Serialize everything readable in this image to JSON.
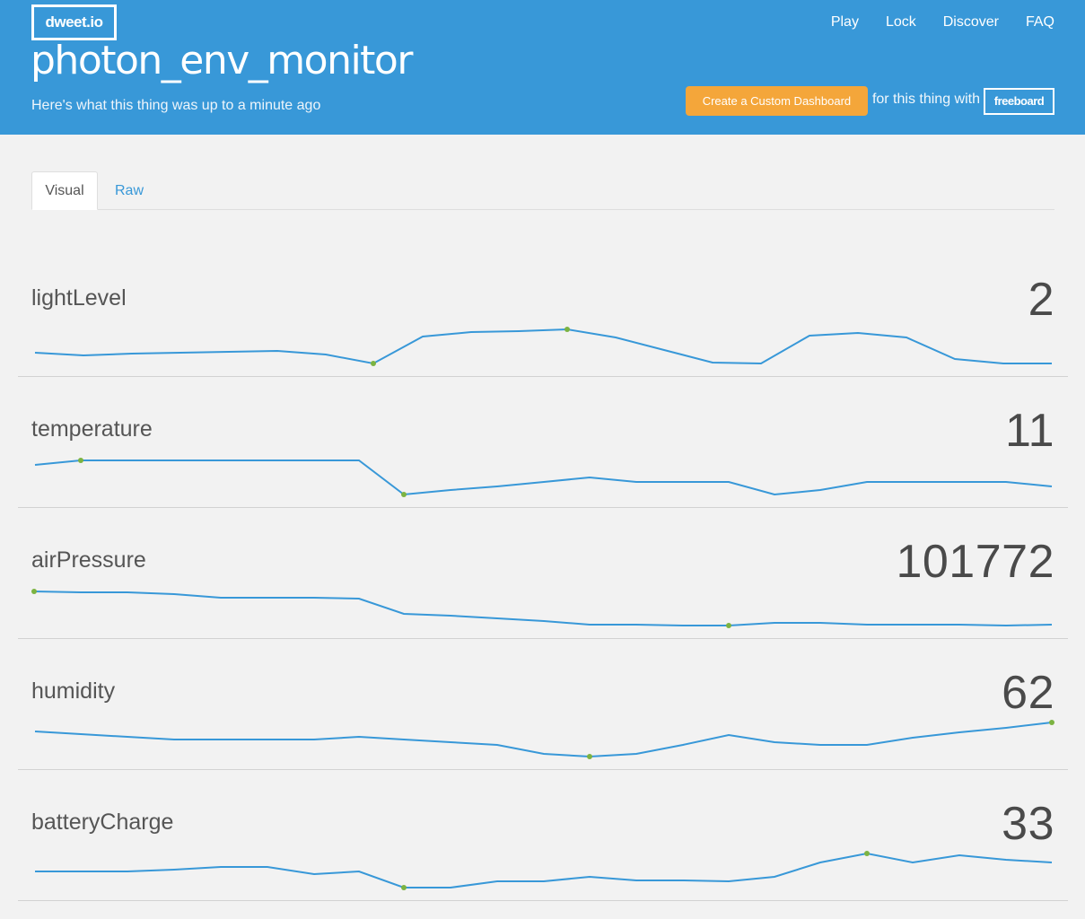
{
  "header": {
    "logo": "dweet.io",
    "thing_name": "photon_env_monitor",
    "subtitle": "Here's what this thing was up to a minute ago",
    "nav": [
      "Play",
      "Lock",
      "Discover",
      "FAQ"
    ],
    "cta_label": "Create a Custom Dashboard",
    "with_text": "for this thing with",
    "freeboard_label": "freeboard"
  },
  "tabs": [
    "Visual",
    "Raw"
  ],
  "colors": {
    "header_bg": "#3898d8",
    "accent": "#f4a63a",
    "line": "#3898d8",
    "marker": "#7cb342"
  },
  "metrics": [
    {
      "name": "lightLevel",
      "value": "2"
    },
    {
      "name": "temperature",
      "value": "11"
    },
    {
      "name": "airPressure",
      "value": "101772"
    },
    {
      "name": "humidity",
      "value": "62"
    },
    {
      "name": "batteryCharge",
      "value": "33"
    }
  ]
}
